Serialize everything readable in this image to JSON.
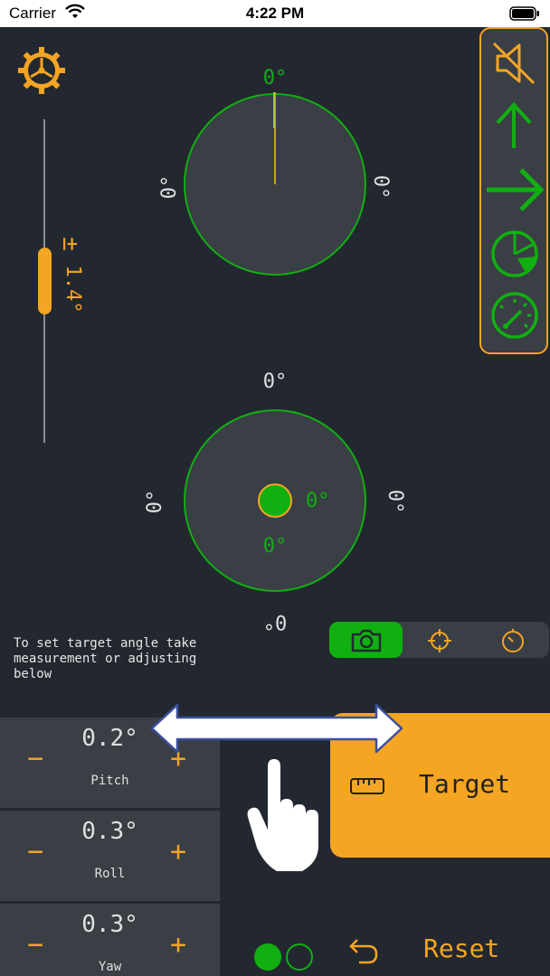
{
  "status_bar": {
    "carrier": "Carrier",
    "time": "4:22 PM"
  },
  "compass": {
    "top": "0°",
    "left": "0°",
    "right": "0°"
  },
  "sensitivity": {
    "plus_minus": "±",
    "value": "1.4°"
  },
  "level": {
    "top": "0°",
    "left": "0°",
    "right": "0°",
    "bottom": "0°",
    "bubble_x": "0°",
    "bubble_y": "0°"
  },
  "hint_text": "To set target angle take measurement or adjusting below",
  "controls": [
    {
      "value": "0.2°",
      "label": "Pitch",
      "minus": "−",
      "plus": "+"
    },
    {
      "value": "0.3°",
      "label": "Roll",
      "minus": "−",
      "plus": "+"
    },
    {
      "value": "0.3°",
      "label": "Yaw",
      "minus": "−",
      "plus": "+"
    }
  ],
  "target_button": {
    "label": "Target"
  },
  "reset_label": "Reset",
  "icons": {
    "settings": "gear-icon",
    "mute": "speaker-muted-icon",
    "arrow_up": "arrow-up-icon",
    "arrow_right": "arrow-right-icon",
    "pie": "pie-chart-icon",
    "gauge": "gauge-icon",
    "camera": "camera-icon",
    "crosshair": "crosshair-icon",
    "timer": "timer-icon",
    "ruler": "ruler-icon",
    "undo": "undo-icon",
    "swipe": "swipe-hint-icon"
  },
  "colors": {
    "accent": "#f4a522",
    "green": "#10b010",
    "background": "#232830",
    "panel": "#3a3e45"
  }
}
